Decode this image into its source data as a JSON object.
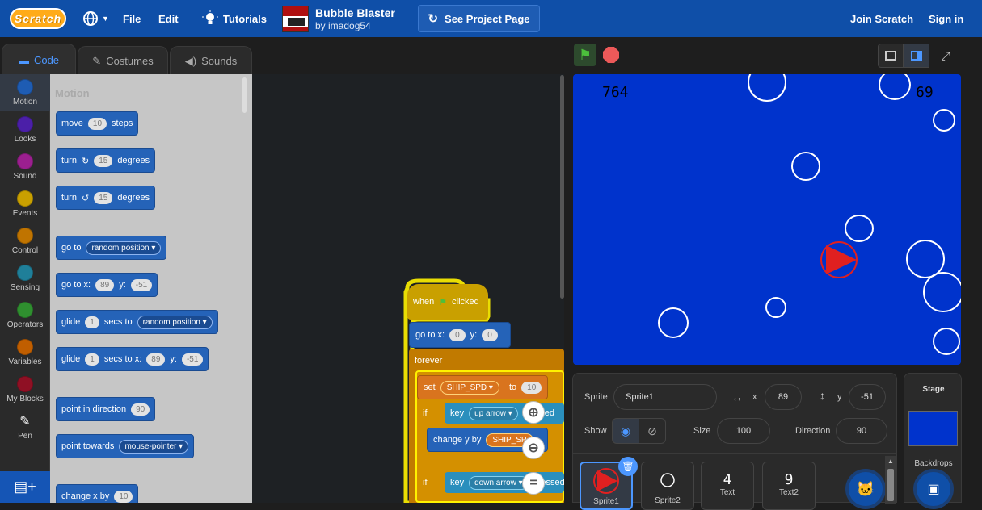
{
  "menubar": {
    "logo": "Scratch",
    "file": "File",
    "edit": "Edit",
    "tutorials": "Tutorials",
    "project_title": "Bubble Blaster",
    "project_author": "by imadog54",
    "see_project": "See Project Page",
    "join": "Join Scratch",
    "signin": "Sign in"
  },
  "tabs": {
    "code": "Code",
    "costumes": "Costumes",
    "sounds": "Sounds"
  },
  "categories": [
    {
      "label": "Motion",
      "color": "#1e5cb3"
    },
    {
      "label": "Looks",
      "color": "#4b1fa8"
    },
    {
      "label": "Sound",
      "color": "#9b1f8f"
    },
    {
      "label": "Events",
      "color": "#c9a000"
    },
    {
      "label": "Control",
      "color": "#c07400"
    },
    {
      "label": "Sensing",
      "color": "#1f7f99"
    },
    {
      "label": "Operators",
      "color": "#2f8f2f"
    },
    {
      "label": "Variables",
      "color": "#c05e00"
    },
    {
      "label": "My Blocks",
      "color": "#8f1024"
    },
    {
      "label": "Pen",
      "color": ""
    }
  ],
  "palette": {
    "title": "Motion",
    "move": {
      "a": "move",
      "n": "10",
      "b": "steps"
    },
    "turn_right": {
      "a": "turn",
      "n": "15",
      "b": "degrees"
    },
    "turn_left": {
      "a": "turn",
      "n": "15",
      "b": "degrees"
    },
    "goto": {
      "a": "go to",
      "d": "random position"
    },
    "goto_xy": {
      "a": "go to x:",
      "x": "89",
      "b": "y:",
      "y": "-51"
    },
    "glide": {
      "a": "glide",
      "n": "1",
      "b": "secs to",
      "d": "random position"
    },
    "glide_xy": {
      "a": "glide",
      "n": "1",
      "b": "secs to x:",
      "x": "89",
      "c": "y:",
      "y": "-51"
    },
    "point_dir": {
      "a": "point in direction",
      "n": "90"
    },
    "point_towards": {
      "a": "point towards",
      "d": "mouse-pointer"
    },
    "change_x": {
      "a": "change x by",
      "n": "10"
    }
  },
  "script": {
    "hat_a": "when",
    "hat_b": "clicked",
    "goto_a": "go to x:",
    "goto_x": "0",
    "goto_b": "y:",
    "goto_y": "0",
    "forever": "forever",
    "set_a": "set",
    "set_var": "SHIP_SPD",
    "set_b": "to",
    "set_val": "10",
    "if1": "if",
    "key1": "key",
    "key1_opt": "up arrow",
    "pressed1": "pressed",
    "chg_a": "change y by",
    "chg_var": "SHIP_SP",
    "if2": "if",
    "key2": "key",
    "key2_opt": "down arrow",
    "pressed2": "pressed"
  },
  "stage": {
    "score_left": "764",
    "score_right": "69",
    "stage_color": "#0033cc"
  },
  "sprite_info": {
    "sprite_label": "Sprite",
    "sprite_name": "Sprite1",
    "x_label": "x",
    "x": "89",
    "y_label": "y",
    "y": "-51",
    "show_label": "Show",
    "size_label": "Size",
    "size": "100",
    "direction_label": "Direction",
    "direction": "90"
  },
  "sprites": [
    {
      "name": "Sprite1",
      "glyph": ""
    },
    {
      "name": "Sprite2",
      "glyph": ""
    },
    {
      "name": "Text",
      "glyph": "4"
    },
    {
      "name": "Text2",
      "glyph": "9"
    }
  ],
  "stage_pane": {
    "title": "Stage",
    "backdrops": "Backdrops"
  },
  "icons": {
    "globe": "globe-icon",
    "bulb": "lightbulb-icon",
    "flag": "green-flag-icon",
    "stop": "stop-icon"
  }
}
